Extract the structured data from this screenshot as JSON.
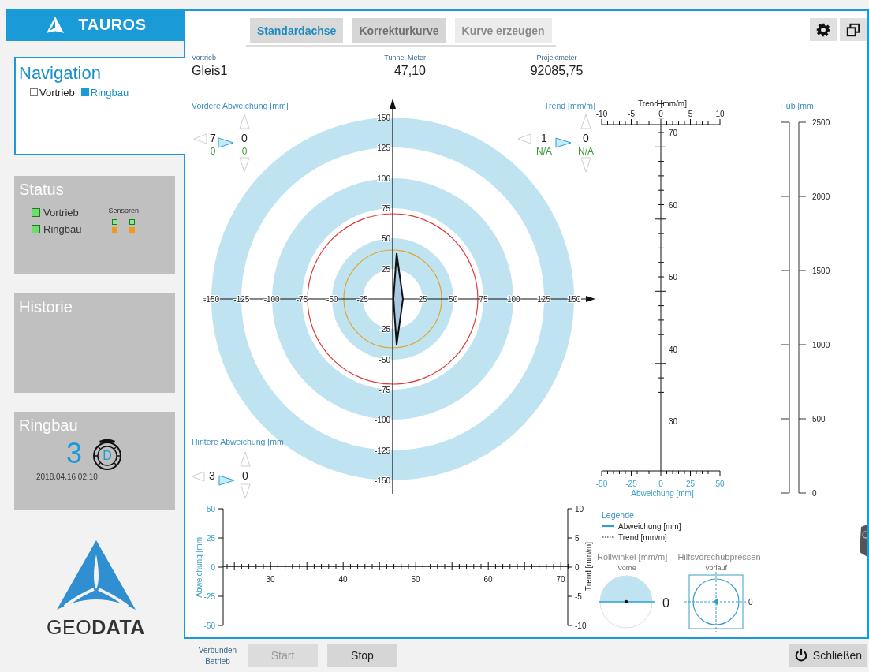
{
  "app": {
    "title": "TAUROS"
  },
  "navigation": {
    "title": "Navigation",
    "items": [
      {
        "label": "Vortrieb",
        "selected": false
      },
      {
        "label": "Ringbau",
        "selected": true
      }
    ]
  },
  "status": {
    "title": "Status",
    "items": [
      {
        "label": "Vortrieb",
        "color": "#6fdc6f"
      },
      {
        "label": "Ringbau",
        "color": "#6fdc6f"
      }
    ],
    "sensors_label": "Sensoren",
    "sensors": [
      {
        "color": "#8fe88f"
      },
      {
        "color": "#8fe88f"
      },
      {
        "color": "#f29a1a"
      },
      {
        "color": "#f29a1a"
      }
    ]
  },
  "history": {
    "title": "Historie"
  },
  "ring": {
    "title": "Ringbau",
    "number": "3",
    "segment": "D",
    "timestamp": "2018.04.16 02:10"
  },
  "logo": {
    "text": "GEO**DATA**"
  },
  "tabs": [
    {
      "label": "Standardachse",
      "selected": true,
      "disabled": false
    },
    {
      "label": "Korrekturkurve",
      "selected": false,
      "disabled": false
    },
    {
      "label": "Kurve erzeugen",
      "selected": false,
      "disabled": true
    }
  ],
  "info": [
    {
      "label": "Vortrieb",
      "value": "Gleis1"
    },
    {
      "label": "Tunnel Meter",
      "value": "47,10"
    },
    {
      "label": "Projektmeter",
      "value": "92085,75"
    }
  ],
  "front_deviation": {
    "title": "Vordere Abweichung [mm]",
    "value_1": "7",
    "sub_1": "0",
    "value_2": "0",
    "sub_2": "0"
  },
  "trend": {
    "title": "Trend [mm/m]",
    "value_1": "1",
    "sub_1": "N/A",
    "value_2": "0",
    "sub_2": "N/A"
  },
  "rear_deviation": {
    "title": "Hintere Abweichung [mm]",
    "value_1": "3",
    "value_2": "0"
  },
  "target": {
    "x_ticks": [
      "-150",
      "-125",
      "-100",
      "-75",
      "-50",
      "-25",
      "25",
      "50",
      "75",
      "100",
      "125",
      "150"
    ],
    "y_ticks": [
      "150",
      "125",
      "100",
      "75",
      "50",
      "25",
      "-25",
      "-50",
      "-75",
      "-100",
      "-125",
      "-150"
    ]
  },
  "trend_chart": {
    "title": "Trend [mm/m]",
    "top_ticks": [
      "-10",
      "-5",
      "0",
      "5",
      "10"
    ],
    "y_ticks": [
      "70",
      "60",
      "50",
      "40",
      "30"
    ],
    "bottom_ticks": [
      "-50",
      "-25",
      "0",
      "25",
      "50"
    ],
    "xlabel": "Abweichung [mm]"
  },
  "hub": {
    "title": "Hub [mm]",
    "ticks": [
      "2500",
      "2000",
      "1500",
      "1000",
      "500",
      "0"
    ]
  },
  "history_chart": {
    "left_ticks": [
      "50",
      "25",
      "0",
      "-25",
      "-50"
    ],
    "left_label": "Abweichung [mm]",
    "x_ticks": [
      "30",
      "40",
      "50",
      "60",
      "70"
    ],
    "right_ticks": [
      "10",
      "5",
      "0",
      "-5",
      "-10"
    ],
    "right_label": "Trend [mm/m]"
  },
  "legend": {
    "title": "Legende",
    "items": [
      {
        "label": "Abweichung [mm]",
        "kind": "solid"
      },
      {
        "label": "Trend [mm/m]",
        "kind": "dotted"
      }
    ]
  },
  "roll": {
    "title": "Rollwinkel [mm/m]",
    "subtitle": "Vorne",
    "value": "0"
  },
  "presses": {
    "title": "Hilfsvorschubpressen",
    "subtitle": "Vorlauf",
    "value": "0"
  },
  "footer": {
    "status_lines": [
      "Verbunden",
      "Betrieb"
    ],
    "buttons": [
      {
        "label": "Start",
        "disabled": true
      },
      {
        "label": "Stop",
        "disabled": false
      }
    ],
    "close": {
      "label": "Schließen"
    }
  }
}
